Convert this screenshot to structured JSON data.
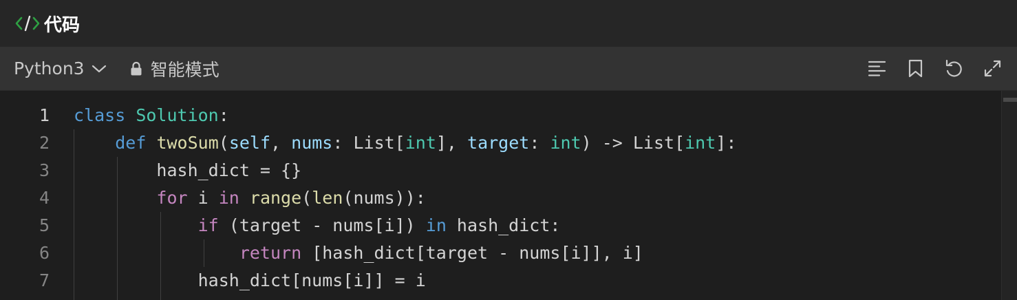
{
  "header": {
    "title": "代码"
  },
  "toolbar": {
    "language": "Python3",
    "mode_label": "智能模式",
    "icons": [
      "format-icon",
      "bookmark-icon",
      "reset-icon",
      "fullscreen-icon"
    ]
  },
  "colors": {
    "keyword": "#569cd6",
    "control": "#c586c0",
    "class": "#4ec9b0",
    "function": "#dcdcaa",
    "parameter": "#9cdcfe",
    "text": "#d4d4d4",
    "accent": "#2ea043"
  },
  "editor": {
    "active_line": 1,
    "lines": [
      {
        "n": "1",
        "tokens": [
          {
            "t": "class",
            "c": "kw"
          },
          {
            "t": " ",
            "c": "tx"
          },
          {
            "t": "Solution",
            "c": "cls"
          },
          {
            "t": ":",
            "c": "tx"
          }
        ]
      },
      {
        "n": "2",
        "tokens": [
          {
            "t": "    ",
            "c": "tx"
          },
          {
            "t": "def",
            "c": "kw"
          },
          {
            "t": " ",
            "c": "tx"
          },
          {
            "t": "twoSum",
            "c": "fn"
          },
          {
            "t": "(",
            "c": "tx"
          },
          {
            "t": "self",
            "c": "param"
          },
          {
            "t": ", ",
            "c": "tx"
          },
          {
            "t": "nums",
            "c": "param"
          },
          {
            "t": ": List[",
            "c": "tx"
          },
          {
            "t": "int",
            "c": "cls"
          },
          {
            "t": "], ",
            "c": "tx"
          },
          {
            "t": "target",
            "c": "param"
          },
          {
            "t": ": ",
            "c": "tx"
          },
          {
            "t": "int",
            "c": "cls"
          },
          {
            "t": ") -> List[",
            "c": "tx"
          },
          {
            "t": "int",
            "c": "cls"
          },
          {
            "t": "]:",
            "c": "tx"
          }
        ]
      },
      {
        "n": "3",
        "tokens": [
          {
            "t": "        hash_dict = {}",
            "c": "tx"
          }
        ]
      },
      {
        "n": "4",
        "tokens": [
          {
            "t": "        ",
            "c": "tx"
          },
          {
            "t": "for",
            "c": "ctrl"
          },
          {
            "t": " i ",
            "c": "tx"
          },
          {
            "t": "in",
            "c": "ctrl"
          },
          {
            "t": " ",
            "c": "tx"
          },
          {
            "t": "range",
            "c": "fn"
          },
          {
            "t": "(",
            "c": "tx"
          },
          {
            "t": "len",
            "c": "fn"
          },
          {
            "t": "(nums)):",
            "c": "tx"
          }
        ]
      },
      {
        "n": "5",
        "tokens": [
          {
            "t": "            ",
            "c": "tx"
          },
          {
            "t": "if",
            "c": "ctrl"
          },
          {
            "t": " (target - nums[i]) ",
            "c": "tx"
          },
          {
            "t": "in",
            "c": "kw"
          },
          {
            "t": " hash_dict:",
            "c": "tx"
          }
        ]
      },
      {
        "n": "6",
        "tokens": [
          {
            "t": "                ",
            "c": "tx"
          },
          {
            "t": "return",
            "c": "ctrl"
          },
          {
            "t": " [hash_dict[target - nums[i]], i]",
            "c": "tx"
          }
        ]
      },
      {
        "n": "7",
        "tokens": [
          {
            "t": "            hash_dict[nums[i]] = i",
            "c": "tx"
          }
        ]
      }
    ]
  }
}
